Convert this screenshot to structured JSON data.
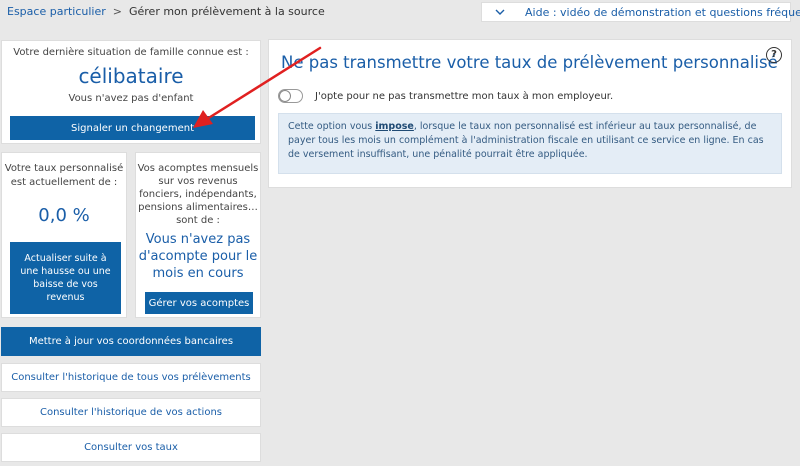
{
  "breadcrumb": {
    "link": "Espace particulier",
    "separator": ">",
    "current": "Gérer mon prélèvement à la source"
  },
  "help_bar": {
    "icon": "chevron-down-icon",
    "label": "Aide : vidéo de démonstration et questions fréquentes"
  },
  "family": {
    "intro": "Votre dernière situation de famille connue est :",
    "status": "célibataire",
    "children": "Vous n'avez pas d'enfant",
    "button": "Signaler un changement"
  },
  "taux": {
    "intro_line1": "Votre taux personnalisé",
    "intro_line2": "est actuellement de :",
    "rate": "0,0 %",
    "button_line1": "Actualiser suite à",
    "button_line2": "une hausse ou une",
    "button_line3": "baisse de vos",
    "button_line4": "revenus"
  },
  "acomptes": {
    "intro_line1": "Vos acomptes mensuels",
    "intro_line2": "sur vos revenus",
    "intro_line3": "fonciers, indépendants,",
    "intro_line4": "pensions alimentaires…",
    "intro_line5": "sont de :",
    "none_line1": "Vous n'avez pas",
    "none_line2": "d'acompte pour le",
    "none_line3": "mois en cours",
    "button": "Gérer vos acomptes"
  },
  "actions": {
    "bank": "Mettre à jour vos coordonnées bancaires",
    "history_prelevements": "Consulter l'historique de tous vos prélèvements",
    "history_actions": "Consulter l'historique de vos actions",
    "consult_taux": "Consulter vos taux"
  },
  "main": {
    "title": "Ne pas transmettre votre taux de prélèvement personnalisé",
    "help_icon": "?",
    "toggle_label": "J'opte pour ne pas transmettre mon taux à mon employeur.",
    "toggle_state": "off",
    "info_before": "Cette option vous ",
    "info_strong": "impose",
    "info_after": ", lorsque le taux non personnalisé est inférieur au taux personnalisé, de payer tous les mois un complément à l'administration fiscale en utilisant ce service en ligne. En cas de versement insuffisant, une pénalité pourrait être appliquée."
  },
  "colors": {
    "accent": "#0f63a6",
    "link": "#1a5ea8",
    "annotation_arrow": "#e02020",
    "info_bg": "#e4edf6"
  }
}
